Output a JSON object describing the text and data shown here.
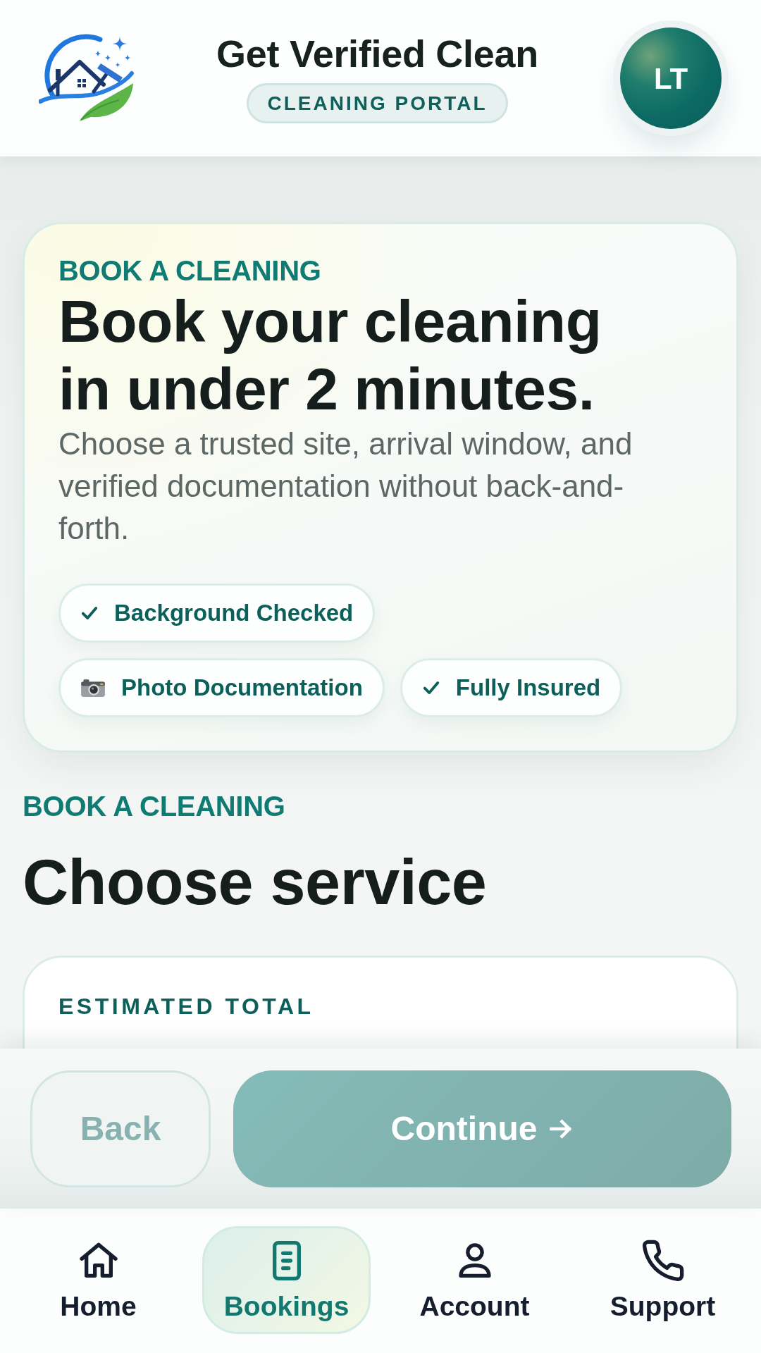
{
  "header": {
    "title": "Get Verified Clean",
    "tag": "CLEANING PORTAL",
    "avatar_initials": "LT"
  },
  "hero": {
    "eyebrow": "BOOK A CLEANING",
    "title": "Book your cleaning in under 2 minutes.",
    "description": "Choose a trusted site, arrival window, and verified documentation without back-and-forth.",
    "badges": [
      {
        "kind": "check",
        "label": "Background Checked"
      },
      {
        "kind": "photo",
        "label": "Photo Documentation"
      },
      {
        "kind": "check",
        "label": "Fully Insured"
      }
    ]
  },
  "section": {
    "eyebrow": "BOOK A CLEANING",
    "title": "Choose service"
  },
  "estimate": {
    "label": "ESTIMATED TOTAL"
  },
  "actions": [
    {
      "kind": "back",
      "label": "Back",
      "disabled": true
    },
    {
      "kind": "next",
      "label": "Continue",
      "disabled": true
    }
  ],
  "bottom_nav": [
    {
      "kind": "home",
      "label": "Home",
      "selected": false
    },
    {
      "kind": "bookings",
      "label": "Bookings",
      "selected": true
    },
    {
      "kind": "account",
      "label": "Account",
      "selected": false
    },
    {
      "kind": "support",
      "label": "Support",
      "selected": false
    }
  ]
}
